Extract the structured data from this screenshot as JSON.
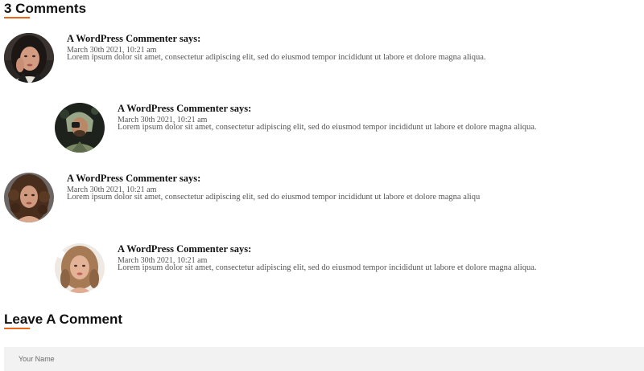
{
  "comments_section": {
    "title": "3 Comments",
    "accent_color": "#e8651a"
  },
  "comments": [
    {
      "author": "A WordPress Commenter says:",
      "date": "March 30th 2021, 10:21 am",
      "text": "Lorem ipsum dolor sit amet, consectetur adipiscing elit, sed do eiusmod tempor incididunt ut labore et dolore magna aliqua.",
      "avatar": "user-avatar-photo",
      "level": 0
    },
    {
      "author": "A WordPress Commenter says:",
      "date": "March 30th 2021, 10:21 am",
      "text": "Lorem ipsum dolor sit amet, consectetur adipiscing elit, sed do eiusmod tempor incididunt ut labore et dolore magna aliqua.",
      "avatar": "user-avatar-photo",
      "level": 1
    },
    {
      "author": "A WordPress Commenter says:",
      "date": "March 30th 2021, 10:21 am",
      "text": "Lorem ipsum dolor sit amet, consectetur adipiscing elit, sed do eiusmod tempor incididunt ut labore et dolore magna aliqu",
      "avatar": "user-avatar-photo",
      "level": 0
    },
    {
      "author": "A WordPress Commenter says:",
      "date": "March 30th 2021, 10:21 am",
      "text": "Lorem ipsum dolor sit amet, consectetur adipiscing elit, sed do eiusmod tempor incididunt ut labore et dolore magna aliqua.",
      "avatar": "user-avatar-photo",
      "level": 1
    }
  ],
  "leave_comment": {
    "title": "Leave A Comment",
    "name_placeholder": "Your Name"
  }
}
